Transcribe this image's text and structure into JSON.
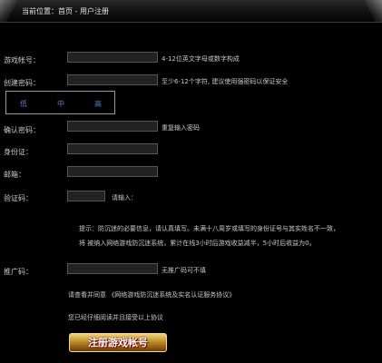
{
  "breadcrumb": "当前位置：首页 - 用户注册",
  "fields": {
    "account": {
      "label": "游戏帐号：",
      "hint": "4-12位英文字母或数字构成"
    },
    "password": {
      "label": "创建密码：",
      "hint": "至少6-12个字符, 建议使用强密码以保证安全"
    },
    "confirm": {
      "label": "确认密码：",
      "hint": "重复输入密码"
    },
    "idcard": {
      "label": "身份证："
    },
    "email": {
      "label": "邮箱："
    },
    "captcha": {
      "label": "验证码：",
      "hint": "请输入："
    },
    "referrer": {
      "label": "推广码：",
      "hint": "无推广码可不填"
    }
  },
  "strength": {
    "low": "低",
    "mid": "中",
    "high": "高"
  },
  "tip": {
    "line1": "提示：防沉迷的必要信息，请认真填写。未满十八周岁或填写的身份证号与其实姓名不一致，",
    "line2": "将  被纳入网络游戏防沉迷系统，累计在线3小时后游戏收益减半，5小时后收益为0。"
  },
  "agreement": "请查看并同意  《网络游戏防沉迷系统及实名认证服务协议》",
  "agreed_text": "您已经仔细阅读并且接受以上协议",
  "submit_label": "注册游戏帐号"
}
